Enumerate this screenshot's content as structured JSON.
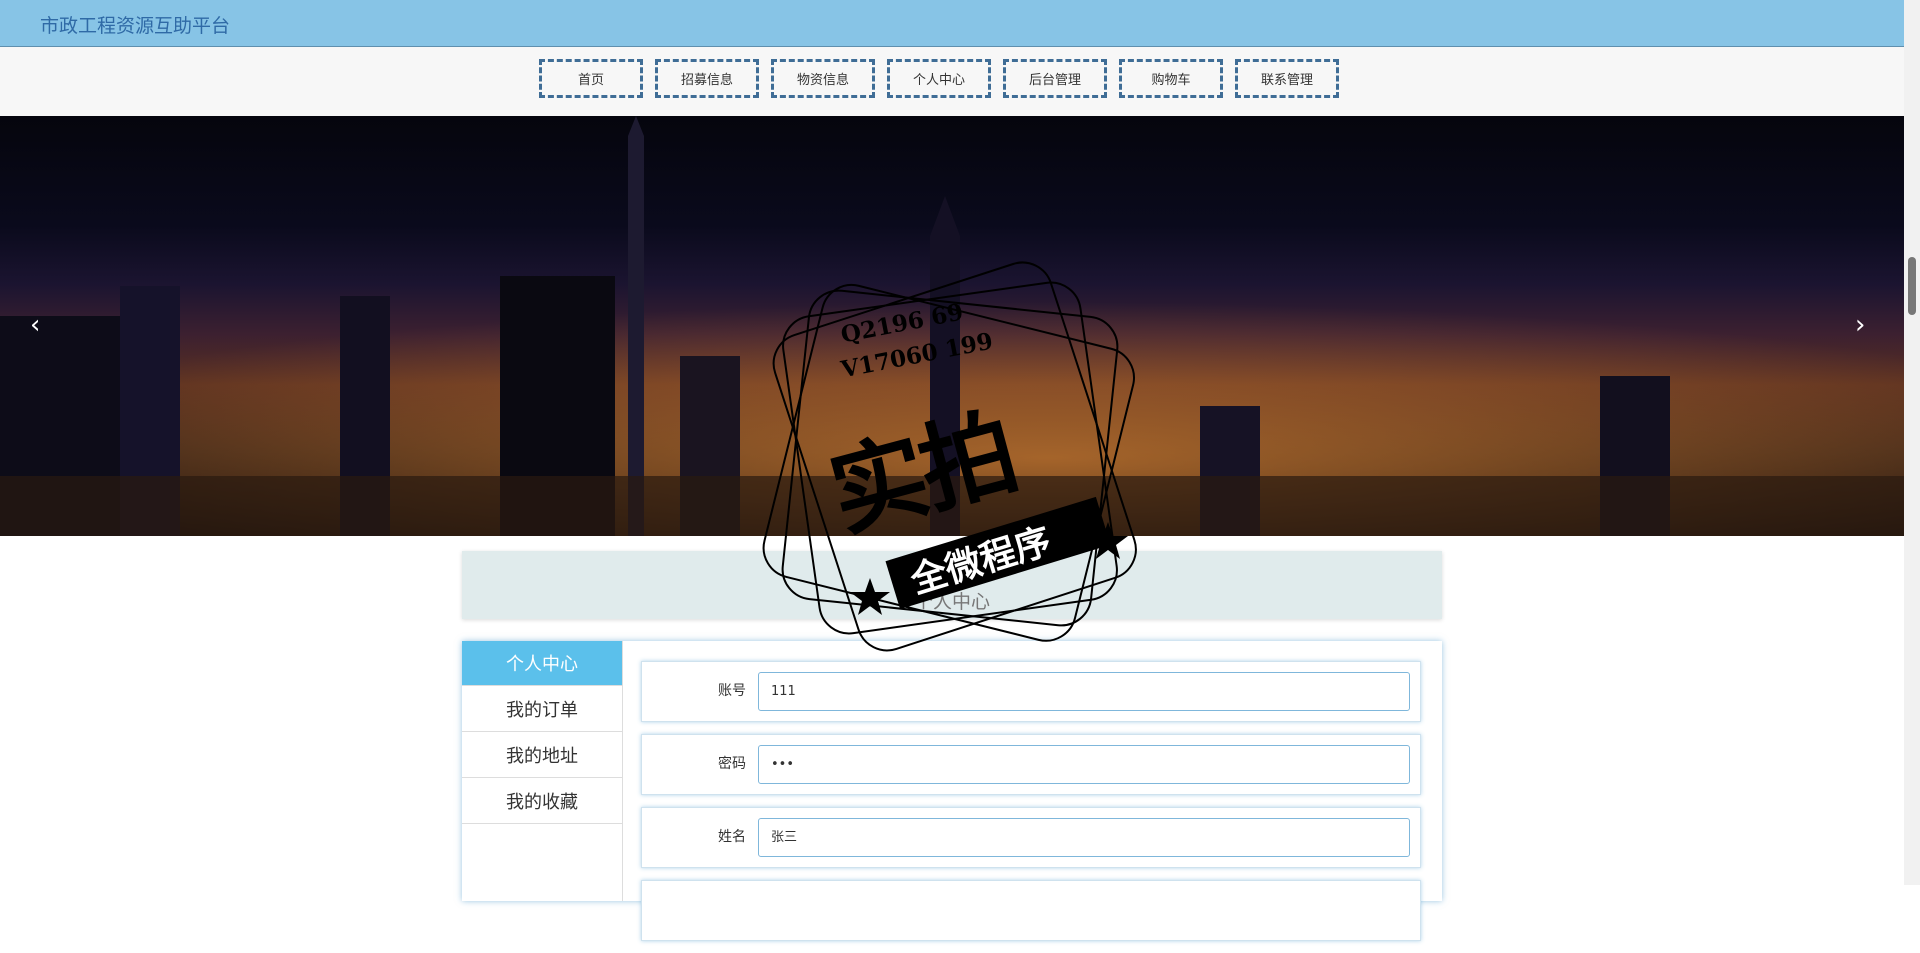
{
  "site": {
    "title": "市政工程资源互助平台"
  },
  "nav": {
    "items": [
      {
        "label": "首页"
      },
      {
        "label": "招募信息"
      },
      {
        "label": "物资信息"
      },
      {
        "label": "个人中心"
      },
      {
        "label": "后台管理"
      },
      {
        "label": "购物车"
      },
      {
        "label": "联系管理"
      }
    ]
  },
  "banner": {
    "prev_glyph": "‹",
    "next_glyph": "›"
  },
  "section": {
    "subtitle": "USER",
    "title": "个人中心"
  },
  "side_menu": {
    "items": [
      {
        "label": "个人中心",
        "active": true
      },
      {
        "label": "我的订单",
        "active": false
      },
      {
        "label": "我的地址",
        "active": false
      },
      {
        "label": "我的收藏",
        "active": false
      }
    ]
  },
  "form": {
    "fields": [
      {
        "label": "账号",
        "value": "111"
      },
      {
        "label": "密码",
        "value": "•••"
      },
      {
        "label": "姓名",
        "value": "张三"
      }
    ]
  },
  "watermark": {
    "line1": "Q2196 69",
    "line2": "V17060 199",
    "big": "实拍",
    "band": "全微程序"
  },
  "colors": {
    "topbar": "#87c4e6",
    "title": "#2f6aa6",
    "nav_border": "#3f6d96",
    "active_menu": "#5bc0eb"
  }
}
